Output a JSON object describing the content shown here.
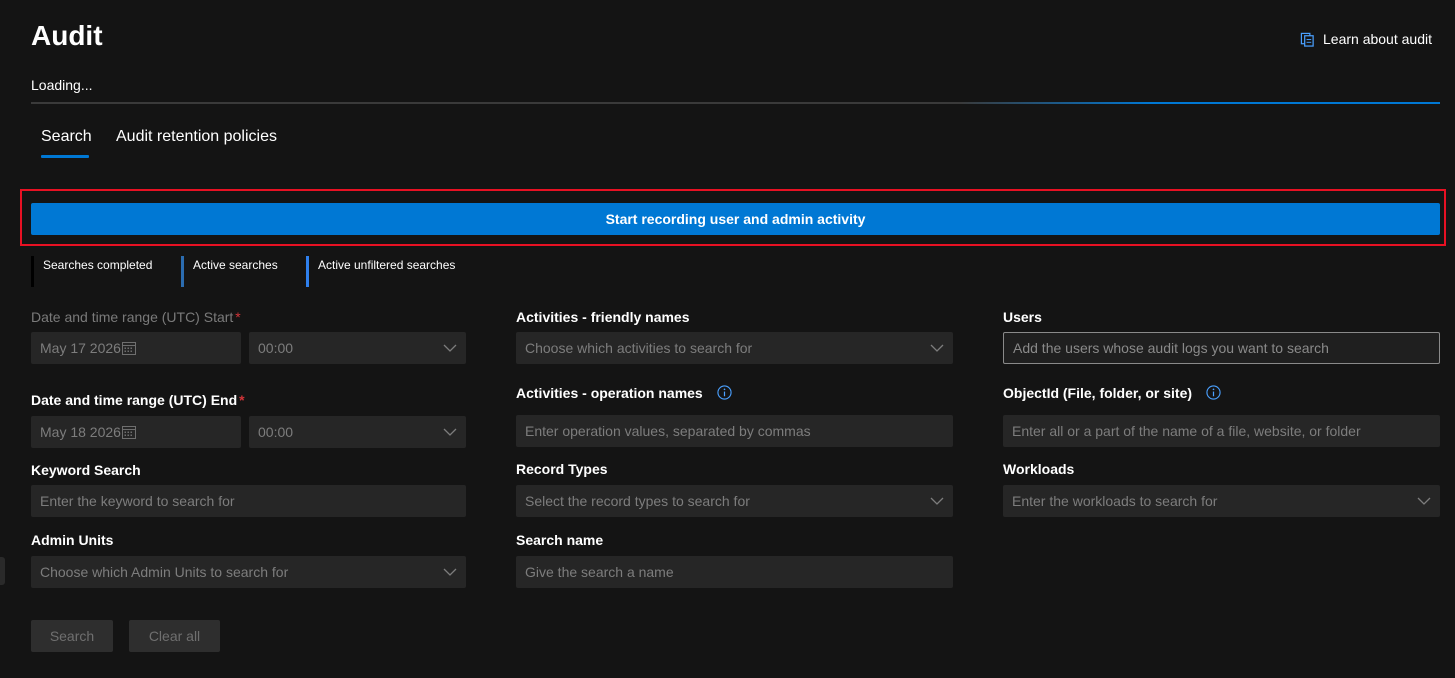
{
  "header": {
    "title": "Audit",
    "learn_link": "Learn about audit",
    "loading": "Loading..."
  },
  "tabs": [
    {
      "label": "Search",
      "active": true
    },
    {
      "label": "Audit retention policies",
      "active": false
    }
  ],
  "record_button": "Start recording user and admin activity",
  "legend": {
    "completed": "Searches completed",
    "active": "Active searches",
    "unfiltered": "Active unfiltered searches"
  },
  "form": {
    "start": {
      "label": "Date and time range (UTC) Start",
      "required": "*",
      "date": "May 17 2026",
      "time": "00:00"
    },
    "end": {
      "label": "Date and time range (UTC) End",
      "required": "*",
      "date": "May 18 2026",
      "time": "00:00"
    },
    "keyword": {
      "label": "Keyword Search",
      "placeholder": "Enter the keyword to search for"
    },
    "admin_units": {
      "label": "Admin Units",
      "placeholder": "Choose which Admin Units to search for"
    },
    "activities_friendly": {
      "label": "Activities - friendly names",
      "placeholder": "Choose which activities to search for"
    },
    "activities_operation": {
      "label": "Activities - operation names",
      "placeholder": "Enter operation values, separated by commas"
    },
    "record_types": {
      "label": "Record Types",
      "placeholder": "Select the record types to search for"
    },
    "search_name": {
      "label": "Search name",
      "placeholder": "Give the search a name"
    },
    "users": {
      "label": "Users",
      "placeholder": "Add the users whose audit logs you want to search"
    },
    "object_id": {
      "label": "ObjectId (File, folder, or site)",
      "placeholder": "Enter all or a part of the name of a file, website, or folder"
    },
    "workloads": {
      "label": "Workloads",
      "placeholder": "Enter the workloads to search for"
    }
  },
  "actions": {
    "search": "Search",
    "clear": "Clear all"
  },
  "colors": {
    "accent": "#0078d4",
    "highlight": "#e81123",
    "required": "#d13438"
  }
}
